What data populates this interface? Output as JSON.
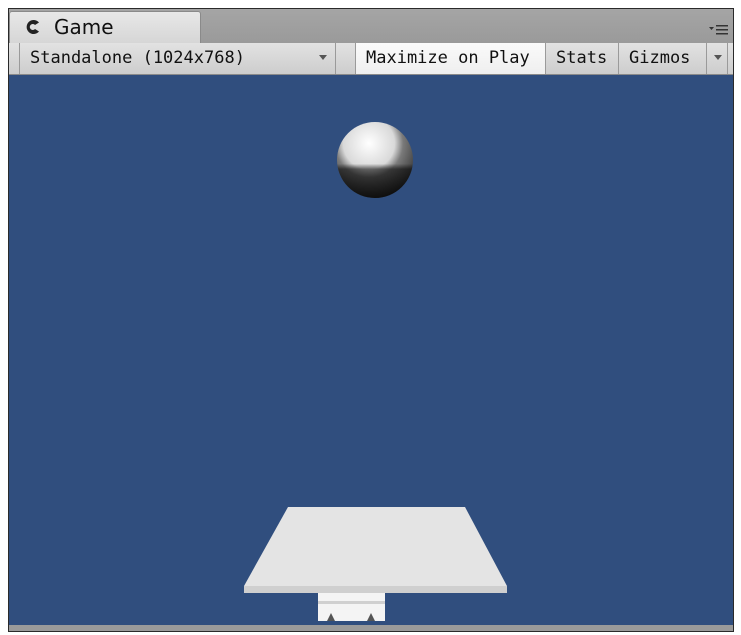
{
  "window": {
    "tab_title": "Game",
    "tab_icon": "unity-game-icon",
    "menu_icon": "panel-menu-icon"
  },
  "toolbar": {
    "aspect_label": "Standalone (1024x768)",
    "maximize_label": "Maximize on Play",
    "stats_label": "Stats",
    "gizmos_label": "Gizmos"
  },
  "scene": {
    "background_color": "#304e7e",
    "objects": [
      "sphere",
      "platform",
      "platform-base"
    ]
  }
}
